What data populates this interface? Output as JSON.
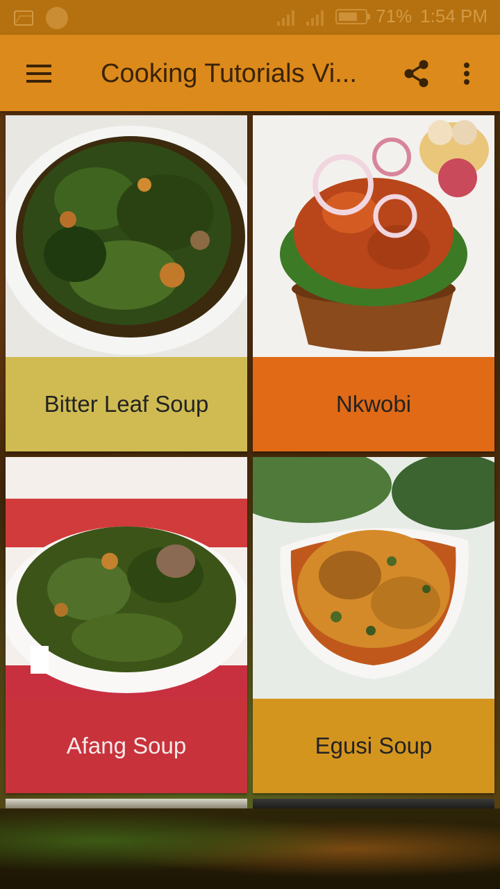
{
  "status_bar": {
    "battery": "71%",
    "time": "1:54 PM"
  },
  "app_bar": {
    "title": "Cooking Tutorials Vi...",
    "menu_icon": "hamburger-menu-icon",
    "share_icon": "share-icon",
    "more_icon": "more-vert-icon"
  },
  "cards": [
    {
      "title": "Bitter Leaf Soup",
      "label_color": "#cfbb52",
      "text_color": "#222222",
      "image": "bitter-leaf-soup-photo"
    },
    {
      "title": "Nkwobi",
      "label_color": "#e06a16",
      "text_color": "#222222",
      "image": "nkwobi-photo"
    },
    {
      "title": "Afang Soup",
      "label_color": "#c8323b",
      "text_color": "#f4eaea",
      "image": "afang-soup-photo"
    },
    {
      "title": "Egusi Soup",
      "label_color": "#d4951f",
      "text_color": "#222222",
      "image": "egusi-soup-photo"
    }
  ]
}
